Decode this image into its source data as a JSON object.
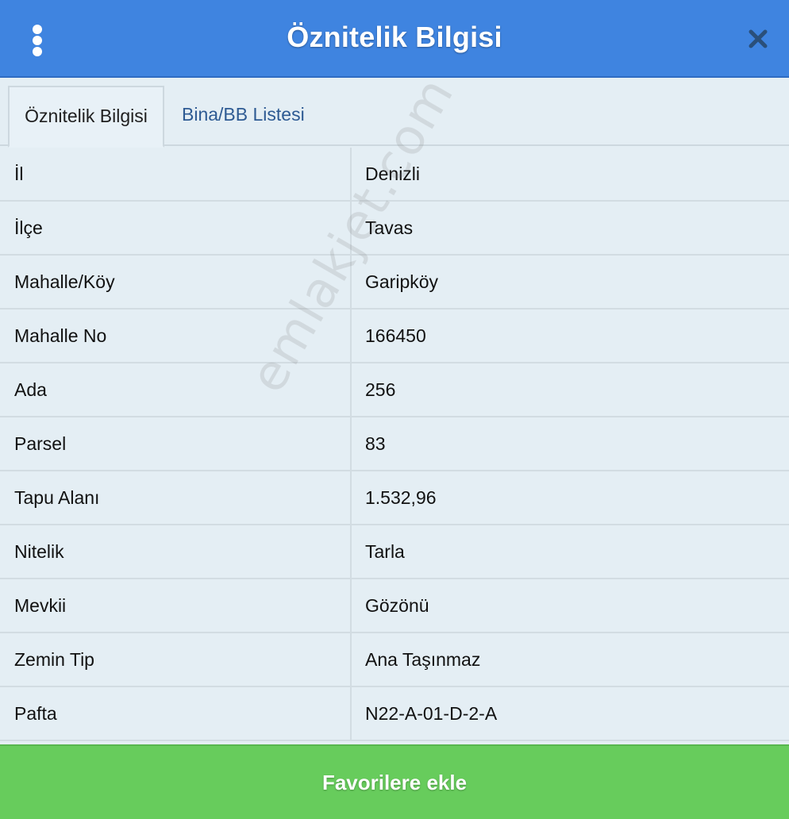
{
  "header": {
    "title": "Öznitelik Bilgisi",
    "menu_icon": "vertical-ellipsis-icon",
    "close_icon": "close-icon"
  },
  "tabs": [
    {
      "label": "Öznitelik Bilgisi",
      "active": true
    },
    {
      "label": "Bina/BB Listesi",
      "active": false
    }
  ],
  "attributes": [
    {
      "key": "İl",
      "value": "Denizli"
    },
    {
      "key": "İlçe",
      "value": "Tavas"
    },
    {
      "key": "Mahalle/Köy",
      "value": "Garipköy"
    },
    {
      "key": "Mahalle No",
      "value": "166450"
    },
    {
      "key": "Ada",
      "value": "256"
    },
    {
      "key": "Parsel",
      "value": "83"
    },
    {
      "key": "Tapu Alanı",
      "value": "1.532,96"
    },
    {
      "key": "Nitelik",
      "value": "Tarla"
    },
    {
      "key": "Mevkii",
      "value": "Gözönü"
    },
    {
      "key": "Zemin Tip",
      "value": "Ana Taşınmaz"
    },
    {
      "key": "Pafta",
      "value": "N22-A-01-D-2-A"
    }
  ],
  "watermark": "emlakjet.com",
  "footer": {
    "button_label": "Favorilere ekle"
  },
  "colors": {
    "header": "#3f84e0",
    "footer": "#67cc5c",
    "background": "#e4eef4",
    "tab_link": "#2d5a93"
  }
}
